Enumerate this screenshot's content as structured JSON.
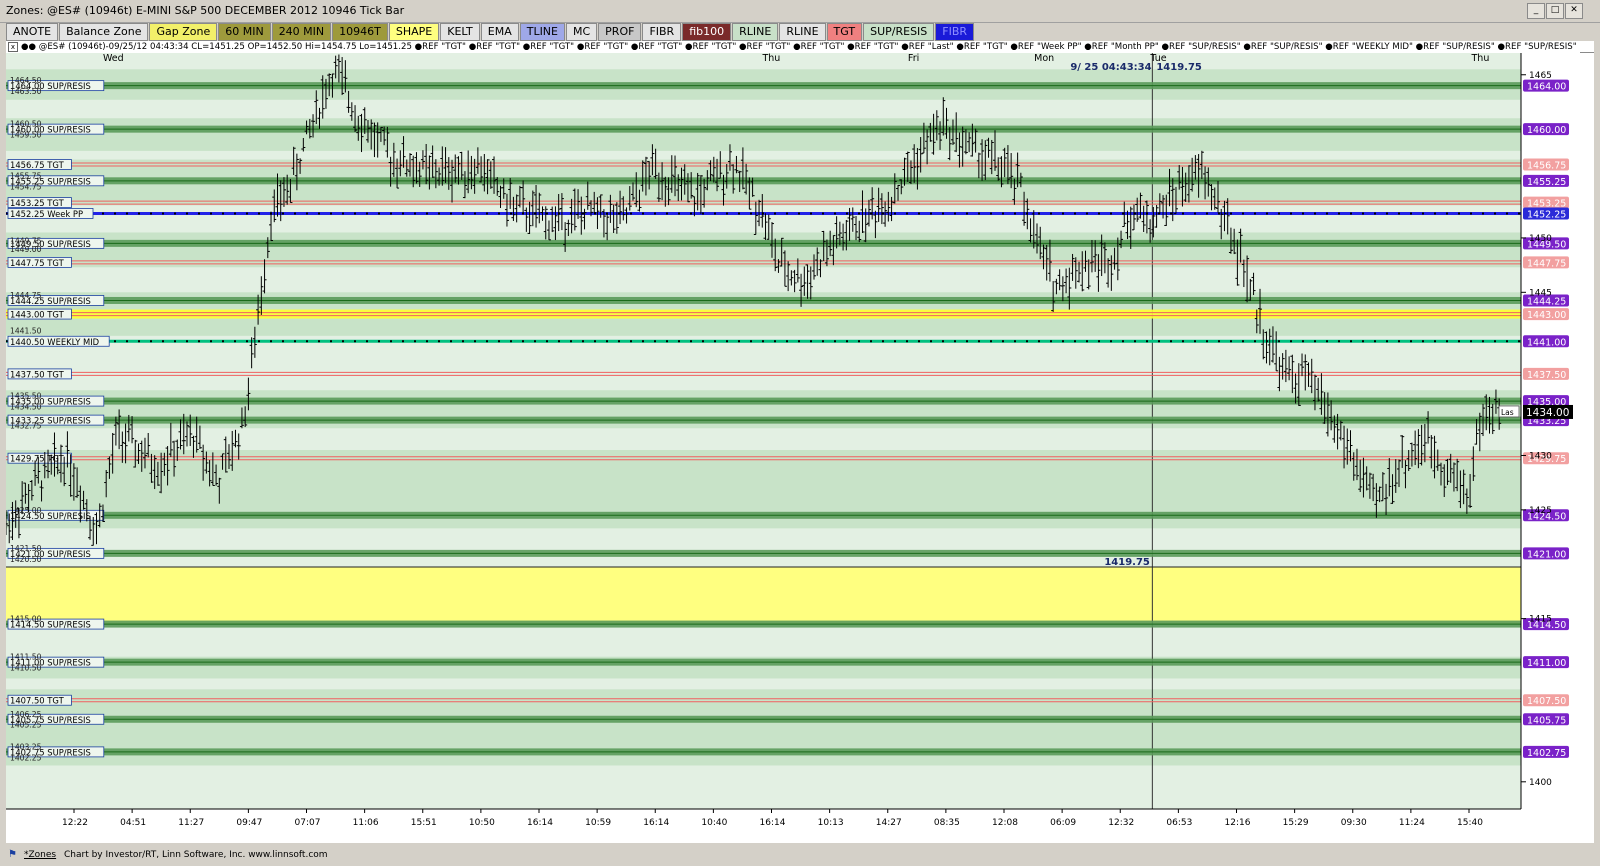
{
  "window": {
    "title": "Zones: @ES# (10946t) E-MINI S&P 500 DECEMBER 2012 10946 Tick Bar",
    "min_label": "_",
    "max_label": "□",
    "close_label": "✕",
    "restore_label": "M"
  },
  "toolbar": {
    "buttons": [
      {
        "label": "ANOTE",
        "bg": "#e4e4e4",
        "fg": "#000000"
      },
      {
        "label": "Balance Zone",
        "bg": "#e4e4e4",
        "fg": "#000000"
      },
      {
        "label": "Gap Zone",
        "bg": "#f2f06a",
        "fg": "#000000"
      },
      {
        "label": "60 MIN",
        "bg": "#9e9a3c",
        "fg": "#000000"
      },
      {
        "label": "240 MIN",
        "bg": "#9e9a3c",
        "fg": "#000000"
      },
      {
        "label": "10946T",
        "bg": "#9e9a3c",
        "fg": "#000000"
      },
      {
        "label": "SHAPE",
        "bg": "#ffff80",
        "fg": "#000000"
      },
      {
        "label": "KELT",
        "bg": "#e4e4e4",
        "fg": "#000000"
      },
      {
        "label": "EMA",
        "bg": "#e4e4e4",
        "fg": "#000000"
      },
      {
        "label": "TLINE",
        "bg": "#9fa8e8",
        "fg": "#000000"
      },
      {
        "label": "MC",
        "bg": "#e4e4e4",
        "fg": "#000000"
      },
      {
        "label": "PROF",
        "bg": "#c8c8c8",
        "fg": "#000000"
      },
      {
        "label": "FIBR",
        "bg": "#e4e4e4",
        "fg": "#000000"
      },
      {
        "label": "fib100",
        "bg": "#7a2a2a",
        "fg": "#ffffff"
      },
      {
        "label": "RLINE",
        "bg": "#c8e0c8",
        "fg": "#000000"
      },
      {
        "label": "RLINE",
        "bg": "#e4e4e4",
        "fg": "#000000"
      },
      {
        "label": "TGT",
        "bg": "#f08080",
        "fg": "#000000"
      },
      {
        "label": "SUP/RESIS",
        "bg": "#c8e0c8",
        "fg": "#000000"
      },
      {
        "label": "FIBR",
        "bg": "#1a1ad8",
        "fg": "#9090ff"
      }
    ]
  },
  "info_bar": {
    "close_label": "x",
    "text": "●● @ES# (10946t)-09/25/12 04:43:34 CL=1451.25 OP=1452.50 Hi=1454.75 Lo=1451.25 ●REF \"TGT\" ●REF \"TGT\" ●REF \"TGT\" ●REF \"TGT\" ●REF \"TGT\" ●REF \"TGT\" ●REF \"TGT\" ●REF \"TGT\" ●REF \"TGT\" ●REF \"Last\" ●REF \"TGT\" ●REF \"Week PP\" ●REF \"Month PP\" ●REF \"SUP/RESIS\" ●REF \"SUP/RESIS\" ●REF \"WEEKLY MID\" ●REF \"SUP/RESIS\" ●REF \"SUP/RESIS\""
  },
  "footer": {
    "zones_label": "*Zones",
    "credit": "Chart by Investor/RT, Linn Software, Inc. www.linnsoft.com"
  },
  "chart_data": {
    "type": "candlestick",
    "title": "",
    "ylim": [
      1397.5,
      1467.0
    ],
    "x_count": 1500,
    "cursor": {
      "x": 1135,
      "date_label": "9/ 25 04:43:34",
      "price_label": "1419.75"
    },
    "last_price": {
      "value": 1434.0,
      "label": "1434.00",
      "tag": "Las"
    },
    "day_labels": [
      {
        "label": "Wed",
        "x": 96
      },
      {
        "label": "Thu",
        "x": 749
      },
      {
        "label": "Fri",
        "x": 893
      },
      {
        "label": "Mon",
        "x": 1018
      },
      {
        "label": "Tue",
        "x": 1133
      },
      {
        "label": "Thu",
        "x": 1451
      }
    ],
    "day_separators": [
      1135
    ],
    "x_tick_labels": [
      "12:22",
      "04:51",
      "11:27",
      "09:47",
      "07:07",
      "11:06",
      "15:51",
      "10:50",
      "16:14",
      "10:59",
      "16:14",
      "10:40",
      "16:14",
      "10:13",
      "14:27",
      "08:35",
      "12:08",
      "06:09",
      "12:32",
      "06:53",
      "12:16",
      "15:29",
      "09:30",
      "11:24",
      "15:40"
    ],
    "y_tick_labels": [
      {
        "label": "1465",
        "value": 1465
      },
      {
        "label": "1450",
        "value": 1450
      },
      {
        "label": "1445",
        "value": 1445
      },
      {
        "label": "1430",
        "value": 1430
      },
      {
        "label": "1425",
        "value": 1425
      },
      {
        "label": "1415",
        "value": 1415
      },
      {
        "label": "1400",
        "value": 1400
      }
    ],
    "bands": [
      {
        "from": 1465.5,
        "to": 1462.7,
        "color": "#c8e3c8"
      },
      {
        "from": 1461.0,
        "to": 1458.0,
        "color": "#c8e3c8"
      },
      {
        "from": 1457.2,
        "to": 1453.0,
        "color": "#c8e3c8"
      },
      {
        "from": 1450.5,
        "to": 1447.3,
        "color": "#c8e3c8"
      },
      {
        "from": 1445.0,
        "to": 1441.0,
        "color": "#c8e3c8"
      },
      {
        "from": 1436.0,
        "to": 1432.5,
        "color": "#c8e3c8"
      },
      {
        "from": 1430.5,
        "to": 1423.3,
        "color": "#c8e3c8"
      },
      {
        "from": 1419.75,
        "to": 1414.5,
        "color": "#ffff80"
      },
      {
        "from": 1411.5,
        "to": 1409.5,
        "color": "#c8e3c8"
      },
      {
        "from": 1408.5,
        "to": 1401.5,
        "color": "#c8e3c8"
      }
    ],
    "levels": [
      {
        "price": 1464.0,
        "label": "1464.00 SUP/RESIS",
        "tag": "1464.00",
        "kind": "sup"
      },
      {
        "price": 1460.0,
        "label": "1460.00 SUP/RESIS",
        "tag": "1460.00",
        "kind": "sup"
      },
      {
        "price": 1456.75,
        "label": "1456.75 TGT",
        "tag": "1456.75",
        "kind": "tgt"
      },
      {
        "price": 1455.25,
        "label": "1455.25 SUP/RESIS",
        "tag": "1455.25",
        "kind": "sup"
      },
      {
        "price": 1453.25,
        "label": "1453.25 TGT",
        "tag": "1453.25",
        "kind": "tgt"
      },
      {
        "price": 1452.25,
        "label": "1452.25 Week PP",
        "tag": "1452.25",
        "kind": "weekpp"
      },
      {
        "price": 1449.5,
        "label": "1449.50 SUP/RESIS",
        "tag": "1449.50",
        "kind": "sup"
      },
      {
        "price": 1447.75,
        "label": "1447.75 TGT",
        "tag": "1447.75",
        "kind": "tgt"
      },
      {
        "price": 1444.25,
        "label": "1444.25 SUP/RESIS",
        "tag": "1444.25",
        "kind": "sup"
      },
      {
        "price": 1443.0,
        "label": "1443.00 TGT",
        "tag": "1443.00",
        "kind": "tgtyellow"
      },
      {
        "price": 1440.5,
        "label": "1440.50 WEEKLY MID",
        "tag": "1441.00",
        "kind": "weekly"
      },
      {
        "price": 1437.5,
        "label": "1437.50 TGT",
        "tag": "1437.50",
        "kind": "tgt"
      },
      {
        "price": 1435.0,
        "label": "1435.00 SUP/RESIS",
        "tag": "1435.00",
        "kind": "sup"
      },
      {
        "price": 1433.25,
        "label": "1433.25 SUP/RESIS",
        "tag": "1433.25",
        "kind": "sup"
      },
      {
        "price": 1429.75,
        "label": "1429.75 TGT",
        "tag": "1429.75",
        "kind": "tgt"
      },
      {
        "price": 1424.5,
        "label": "1424.50 SUP/RESIS",
        "tag": "1424.50",
        "kind": "sup"
      },
      {
        "price": 1421.0,
        "label": "1421.00 SUP/RESIS",
        "tag": "1421.00",
        "kind": "sup"
      },
      {
        "price": 1414.5,
        "label": "1414.50 SUP/RESIS",
        "tag": "1414.50",
        "kind": "sup"
      },
      {
        "price": 1411.0,
        "label": "1411.00 SUP/RESIS",
        "tag": "1411.00",
        "kind": "sup"
      },
      {
        "price": 1407.5,
        "label": "1407.50 TGT",
        "tag": "1407.50",
        "kind": "tgt"
      },
      {
        "price": 1405.75,
        "label": "1405.75 SUP/RESIS",
        "tag": "1405.75",
        "kind": "sup"
      },
      {
        "price": 1402.75,
        "label": "1402.75 SUP/RESIS",
        "tag": "1402.75",
        "kind": "sup"
      }
    ],
    "minor_price_labels": [
      {
        "value": 1464.5,
        "label": "1464.50"
      },
      {
        "value": 1463.5,
        "label": "1463.50"
      },
      {
        "value": 1460.5,
        "label": "1460.50"
      },
      {
        "value": 1459.5,
        "label": "1459.50"
      },
      {
        "value": 1455.75,
        "label": "1455.75"
      },
      {
        "value": 1454.75,
        "label": "1454.75"
      },
      {
        "value": 1449.75,
        "label": "1449.75"
      },
      {
        "value": 1449.0,
        "label": "1449.00"
      },
      {
        "value": 1444.75,
        "label": "1444.75"
      },
      {
        "value": 1441.5,
        "label": "1441.50"
      },
      {
        "value": 1435.5,
        "label": "1435.50"
      },
      {
        "value": 1434.5,
        "label": "1434.50"
      },
      {
        "value": 1432.75,
        "label": "1432.75"
      },
      {
        "value": 1425.0,
        "label": "1425.00"
      },
      {
        "value": 1421.5,
        "label": "1421.50"
      },
      {
        "value": 1420.5,
        "label": "1420.50"
      },
      {
        "value": 1415.0,
        "label": "1415.00"
      },
      {
        "value": 1411.5,
        "label": "1411.50"
      },
      {
        "value": 1410.5,
        "label": "1410.50"
      },
      {
        "value": 1406.25,
        "label": "1406.25"
      },
      {
        "value": 1405.25,
        "label": "1405.25"
      },
      {
        "value": 1403.25,
        "label": "1403.25"
      },
      {
        "value": 1402.25,
        "label": "1402.25"
      }
    ],
    "price_path": [
      {
        "x": 0,
        "p": 1423.5
      },
      {
        "x": 30,
        "p": 1427.5
      },
      {
        "x": 60,
        "p": 1430.0
      },
      {
        "x": 90,
        "p": 1423.0
      },
      {
        "x": 110,
        "p": 1432.0
      },
      {
        "x": 150,
        "p": 1429.0
      },
      {
        "x": 185,
        "p": 1432.0
      },
      {
        "x": 210,
        "p": 1427.5
      },
      {
        "x": 235,
        "p": 1433.0
      },
      {
        "x": 245,
        "p": 1439.5
      },
      {
        "x": 262,
        "p": 1452.0
      },
      {
        "x": 282,
        "p": 1455.0
      },
      {
        "x": 305,
        "p": 1461.0
      },
      {
        "x": 325,
        "p": 1465.5
      },
      {
        "x": 350,
        "p": 1461.0
      },
      {
        "x": 380,
        "p": 1457.5
      },
      {
        "x": 420,
        "p": 1456.0
      },
      {
        "x": 470,
        "p": 1456.5
      },
      {
        "x": 500,
        "p": 1453.0
      },
      {
        "x": 540,
        "p": 1451.5
      },
      {
        "x": 580,
        "p": 1452.5
      },
      {
        "x": 610,
        "p": 1451.5
      },
      {
        "x": 640,
        "p": 1456.5
      },
      {
        "x": 680,
        "p": 1453.5
      },
      {
        "x": 720,
        "p": 1457.0
      },
      {
        "x": 748,
        "p": 1452.5
      },
      {
        "x": 765,
        "p": 1447.5
      },
      {
        "x": 790,
        "p": 1446.0
      },
      {
        "x": 815,
        "p": 1449.0
      },
      {
        "x": 845,
        "p": 1451.5
      },
      {
        "x": 875,
        "p": 1453.5
      },
      {
        "x": 900,
        "p": 1457.0
      },
      {
        "x": 925,
        "p": 1460.5
      },
      {
        "x": 950,
        "p": 1458.5
      },
      {
        "x": 980,
        "p": 1457.0
      },
      {
        "x": 1005,
        "p": 1454.5
      },
      {
        "x": 1020,
        "p": 1449.5
      },
      {
        "x": 1040,
        "p": 1445.5
      },
      {
        "x": 1065,
        "p": 1447.5
      },
      {
        "x": 1095,
        "p": 1448.0
      },
      {
        "x": 1115,
        "p": 1452.5
      },
      {
        "x": 1135,
        "p": 1451.5
      },
      {
        "x": 1160,
        "p": 1454.5
      },
      {
        "x": 1185,
        "p": 1456.0
      },
      {
        "x": 1205,
        "p": 1452.0
      },
      {
        "x": 1225,
        "p": 1447.5
      },
      {
        "x": 1245,
        "p": 1441.5
      },
      {
        "x": 1265,
        "p": 1437.5
      },
      {
        "x": 1290,
        "p": 1437.0
      },
      {
        "x": 1315,
        "p": 1433.0
      },
      {
        "x": 1340,
        "p": 1428.5
      },
      {
        "x": 1355,
        "p": 1425.5
      },
      {
        "x": 1380,
        "p": 1429.0
      },
      {
        "x": 1405,
        "p": 1431.5
      },
      {
        "x": 1425,
        "p": 1429.0
      },
      {
        "x": 1448,
        "p": 1426.5
      },
      {
        "x": 1460,
        "p": 1433.5
      },
      {
        "x": 1480,
        "p": 1434.0
      }
    ]
  }
}
